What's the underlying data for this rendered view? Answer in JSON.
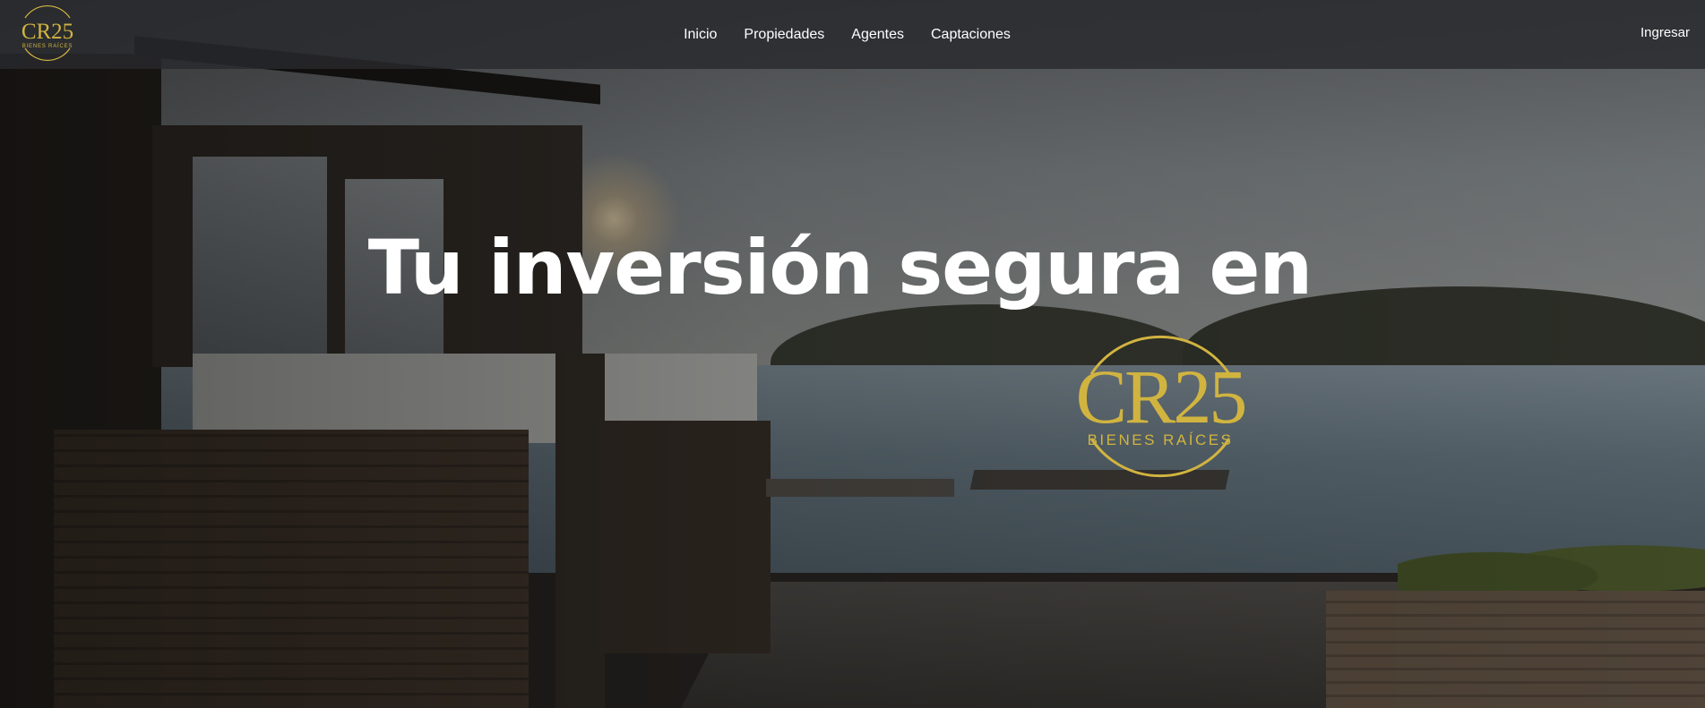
{
  "brand": {
    "name": "CR25",
    "tagline": "BIENES RAÍCES",
    "accent_color": "#d1b440"
  },
  "nav": {
    "items": [
      {
        "label": "Inicio"
      },
      {
        "label": "Propiedades"
      },
      {
        "label": "Agentes"
      },
      {
        "label": "Captaciones"
      }
    ],
    "login_label": "Ingresar"
  },
  "hero": {
    "title": "Tu inversión segura en"
  }
}
